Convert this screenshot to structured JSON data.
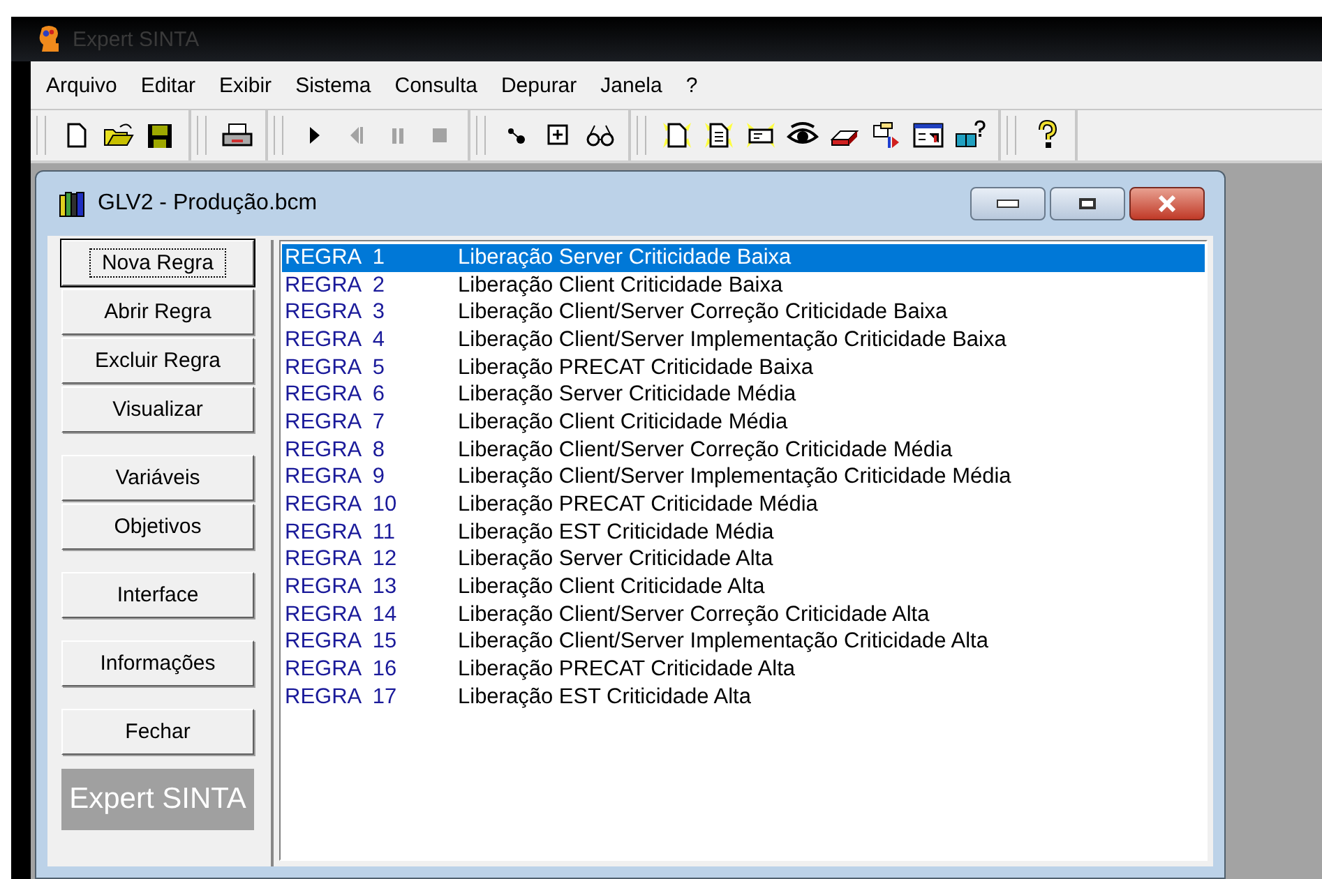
{
  "app": {
    "title": "Expert SINTA"
  },
  "menu": [
    {
      "label": "Arquivo"
    },
    {
      "label": "Editar"
    },
    {
      "label": "Exibir"
    },
    {
      "label": "Sistema"
    },
    {
      "label": "Consulta"
    },
    {
      "label": "Depurar"
    },
    {
      "label": "Janela"
    },
    {
      "label": "?"
    }
  ],
  "toolbar": [
    [
      {
        "kind": "new",
        "disabled": false
      },
      {
        "kind": "open",
        "disabled": false
      },
      {
        "kind": "save",
        "disabled": false
      }
    ],
    [
      {
        "kind": "print",
        "disabled": false
      }
    ],
    [
      {
        "kind": "play",
        "disabled": false
      },
      {
        "kind": "step",
        "disabled": true
      },
      {
        "kind": "pause",
        "disabled": true
      },
      {
        "kind": "stop",
        "disabled": true
      }
    ],
    [
      {
        "kind": "link",
        "disabled": false
      },
      {
        "kind": "plus",
        "disabled": false
      },
      {
        "kind": "glasses",
        "disabled": false
      }
    ],
    [
      {
        "kind": "newdoc",
        "disabled": false
      },
      {
        "kind": "newlist",
        "disabled": false
      },
      {
        "kind": "newcard",
        "disabled": false
      },
      {
        "kind": "eye",
        "disabled": false
      },
      {
        "kind": "stack",
        "disabled": false
      },
      {
        "kind": "run",
        "disabled": false
      },
      {
        "kind": "form",
        "disabled": false
      },
      {
        "kind": "bookhelp",
        "disabled": false
      }
    ],
    [
      {
        "kind": "help",
        "disabled": false
      }
    ]
  ],
  "window": {
    "title": "GLV2 - Produção.bcm"
  },
  "button_groups": [
    [
      {
        "label": "Nova Regra",
        "focused": true
      },
      {
        "label": "Abrir Regra",
        "focused": false
      },
      {
        "label": "Excluir Regra",
        "focused": false
      },
      {
        "label": "Visualizar",
        "focused": false
      }
    ],
    [
      {
        "label": "Variáveis",
        "focused": false
      },
      {
        "label": "Objetivos",
        "focused": false
      }
    ],
    [
      {
        "label": "Interface",
        "focused": false
      }
    ],
    [
      {
        "label": "Informações",
        "focused": false
      }
    ],
    [
      {
        "label": "Fechar",
        "focused": false
      }
    ]
  ],
  "brand_label": "Expert SINTA",
  "rules": [
    {
      "id": "REGRA  1",
      "text": "Liberação Server Criticidade Baixa",
      "selected": true
    },
    {
      "id": "REGRA  2",
      "text": "Liberação Client Criticidade Baixa",
      "selected": false
    },
    {
      "id": "REGRA  3",
      "text": "Liberação Client/Server Correção Criticidade Baixa",
      "selected": false
    },
    {
      "id": "REGRA  4",
      "text": "Liberação Client/Server Implementação Criticidade Baixa",
      "selected": false
    },
    {
      "id": "REGRA  5",
      "text": "Liberação PRECAT Criticidade Baixa",
      "selected": false
    },
    {
      "id": "REGRA  6",
      "text": "Liberação Server Criticidade Média",
      "selected": false
    },
    {
      "id": "REGRA  7",
      "text": "Liberação Client Criticidade Média",
      "selected": false
    },
    {
      "id": "REGRA  8",
      "text": "Liberação Client/Server Correção Criticidade Média",
      "selected": false
    },
    {
      "id": "REGRA  9",
      "text": "Liberação Client/Server Implementação Criticidade Média",
      "selected": false
    },
    {
      "id": "REGRA  10",
      "text": "Liberação PRECAT Criticidade Média",
      "selected": false
    },
    {
      "id": "REGRA  11",
      "text": "Liberação EST Criticidade Média",
      "selected": false
    },
    {
      "id": "REGRA  12",
      "text": "Liberação Server Criticidade Alta",
      "selected": false
    },
    {
      "id": "REGRA  13",
      "text": "Liberação Client Criticidade Alta",
      "selected": false
    },
    {
      "id": "REGRA  14",
      "text": "Liberação Client/Server Correção Criticidade Alta",
      "selected": false
    },
    {
      "id": "REGRA  15",
      "text": "Liberação Client/Server Implementação Criticidade Alta",
      "selected": false
    },
    {
      "id": "REGRA  16",
      "text": "Liberação PRECAT Criticidade Alta",
      "selected": false
    },
    {
      "id": "REGRA  17",
      "text": "Liberação EST Criticidade Alta",
      "selected": false
    }
  ]
}
